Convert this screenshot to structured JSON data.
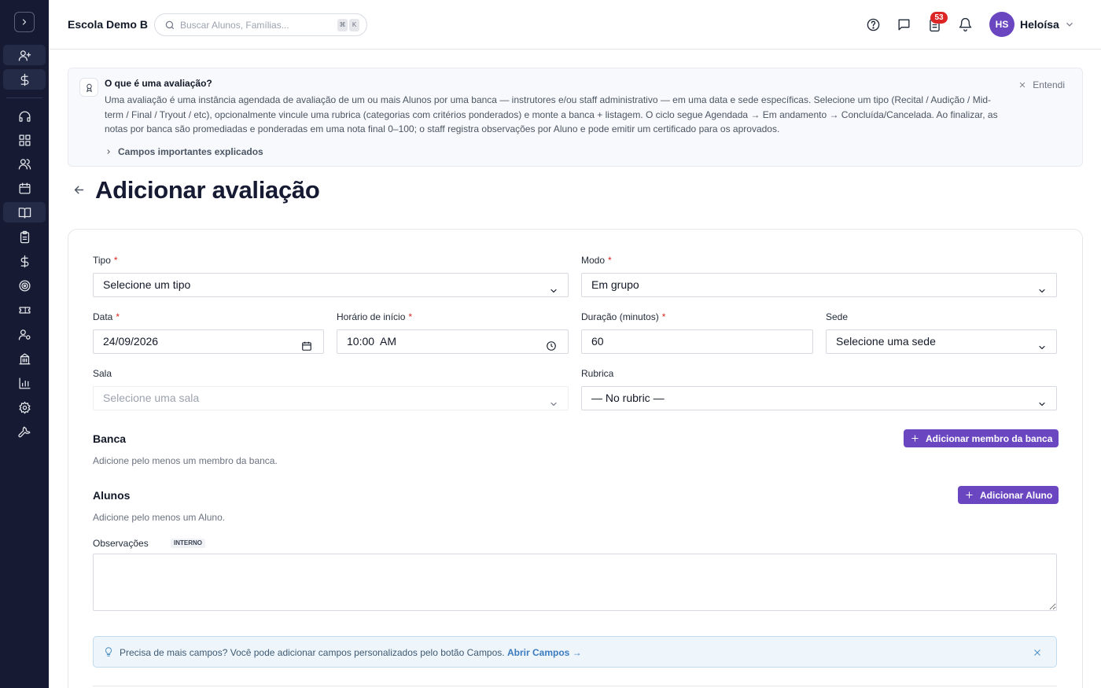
{
  "header": {
    "school": "Escola Demo B",
    "search_placeholder": "Buscar Alunos, Famílias...",
    "kbd": [
      "⌘",
      "K"
    ],
    "notification_count": "53",
    "user_initials": "HS",
    "user_name": "Heloísa"
  },
  "sidebar": {
    "items": [
      "add-user",
      "billing",
      "support",
      "dashboard",
      "people",
      "calendar",
      "courses",
      "clipboard",
      "finance",
      "target",
      "tickets",
      "staff",
      "buildings",
      "reports",
      "settings",
      "tools"
    ],
    "active": "courses"
  },
  "info": {
    "title": "O que é uma avaliação?",
    "body": "Uma avaliação é uma instância agendada de avaliação de um ou mais Alunos por uma banca — instrutores e/ou staff administrativo — em uma data e sede específicas. Selecione um tipo (Recital / Audição / Mid-term / Final / Tryout / etc), opcionalmente vincule uma rubrica (categorias com critérios ponderados) e monte a banca + listagem. O ciclo segue Agendada → Em andamento → Concluída/Cancelada. Ao finalizar, as notas por banca são promediadas e ponderadas em uma nota final 0–100; o staff registra observações por Aluno e pode emitir um certificado para os aprovados.",
    "more": "Campos importantes explicados",
    "dismiss": "Entendi"
  },
  "page": {
    "title": "Adicionar avaliação"
  },
  "form": {
    "tipo": {
      "label": "Tipo",
      "value": "Selecione um tipo"
    },
    "modo": {
      "label": "Modo",
      "value": "Em grupo"
    },
    "data": {
      "label": "Data",
      "value": "24/09/2026"
    },
    "horario": {
      "label": "Horário de início",
      "value": "10:00  AM"
    },
    "duracao": {
      "label": "Duração (minutos)",
      "value": "60"
    },
    "sede": {
      "label": "Sede",
      "value": "Selecione uma sede"
    },
    "sala": {
      "label": "Sala",
      "placeholder": "Selecione uma sala"
    },
    "rubrica": {
      "label": "Rubrica",
      "value": "— No rubric —"
    },
    "required_mark": "*",
    "banca": {
      "title": "Banca",
      "hint": "Adicione pelo menos um membro da banca.",
      "button": "Adicionar membro da banca"
    },
    "alunos": {
      "title": "Alunos",
      "hint": "Adicione pelo menos um Aluno.",
      "button": "Adicionar Aluno"
    },
    "observacoes": {
      "label": "Observações",
      "tag": "INTERNO"
    }
  },
  "tip": {
    "text": "Precisa de mais campos? Você pode adicionar campos personalizados pelo botão Campos.",
    "link": "Abrir Campos →"
  },
  "colors": {
    "sidebar": "#161b33",
    "accent": "#6b46c1",
    "danger": "#dc2626",
    "tip_bg": "#eef6fc"
  }
}
